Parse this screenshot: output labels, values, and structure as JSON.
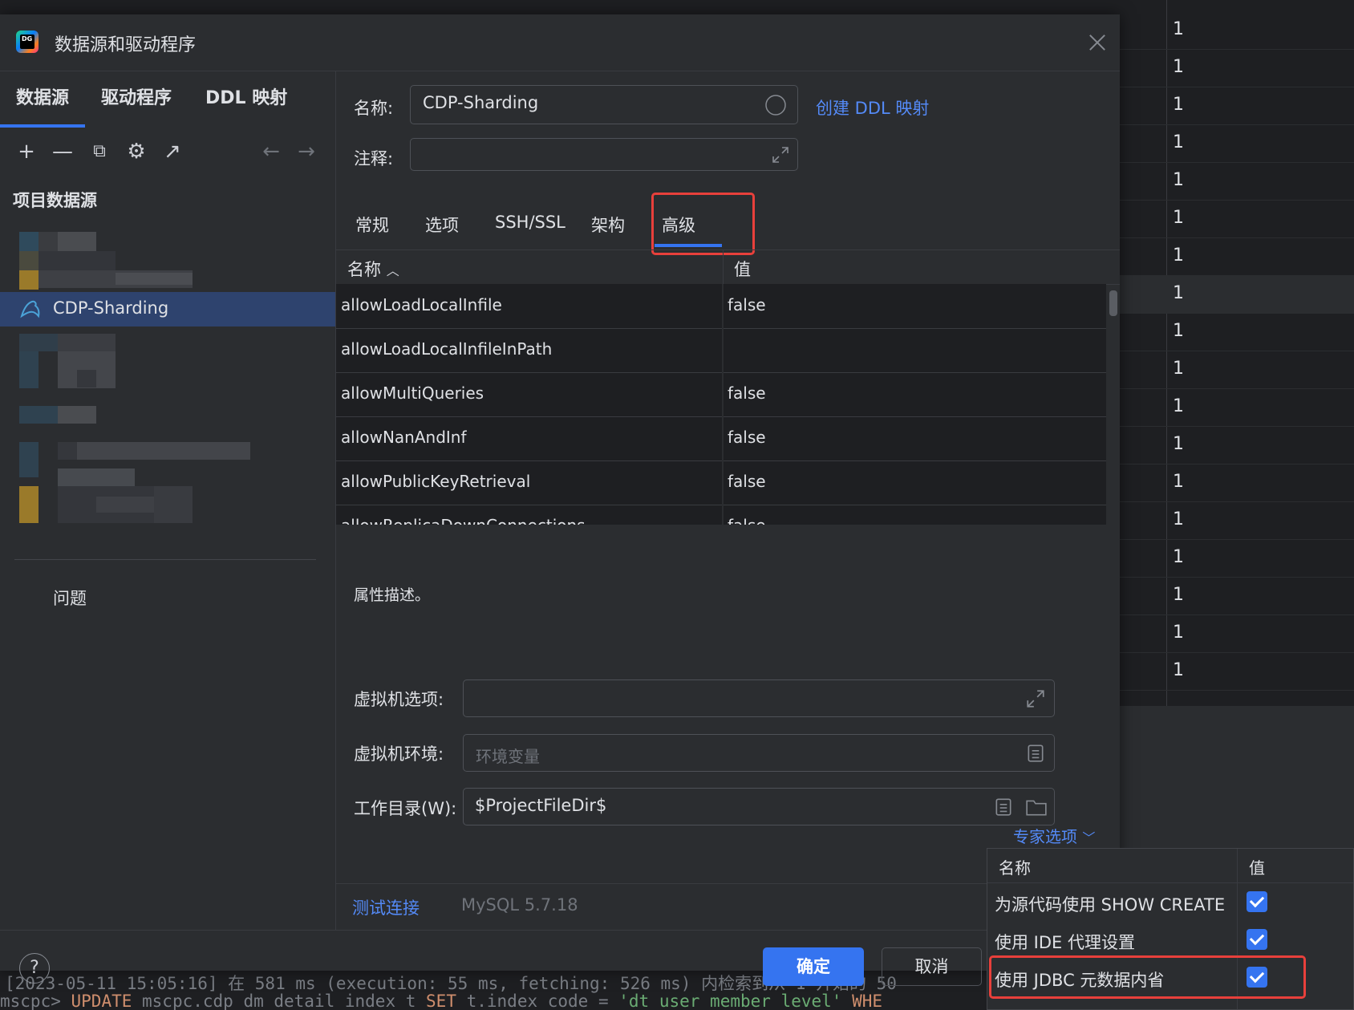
{
  "background": {
    "grid_values": [
      "1",
      "1",
      "1",
      "1",
      "1",
      "1",
      "1",
      "1",
      "1",
      "1",
      "1",
      "1",
      "1",
      "1",
      "1",
      "1",
      "1",
      "1"
    ],
    "console_line1": "[2023-05-11 15:05:16] 在 581 ms (execution: 55 ms, fetching: 526 ms) 内检索到从 1 开始的 50",
    "console_prefix": "mscpc> ",
    "console_kw1": "UPDATE",
    "console_mid": " mscpc.cdp_dm_detail_index t ",
    "console_kw2": "SET",
    "console_mid2": " t.index_code = ",
    "console_str": "'dt_user_member_level'",
    "console_kw3": " WHE"
  },
  "dialog": {
    "logo_text": "DG",
    "title": "数据源和驱动程序"
  },
  "left": {
    "tabs": [
      "数据源",
      "驱动程序",
      "DDL 映射"
    ],
    "toolbar": {
      "add": "+",
      "remove": "—",
      "copy": "⧉",
      "settings": "⚙",
      "open": "↗",
      "back": "←",
      "forward": "→"
    },
    "section_title": "项目数据源",
    "selected_datasource": "CDP-Sharding",
    "problems": "问题"
  },
  "form": {
    "name_label": "名称:",
    "name_value": "CDP-Sharding",
    "create_ddl_link": "创建 DDL 映射",
    "comment_label": "注释:",
    "comment_value": "",
    "tabs": [
      "常规",
      "选项",
      "SSH/SSL",
      "架构",
      "高级"
    ],
    "active_tab": "高级",
    "table": {
      "col_name": "名称",
      "col_value": "值",
      "rows": [
        {
          "key": "allowLoadLocalInfile",
          "value": "false"
        },
        {
          "key": "allowLoadLocalInfileInPath",
          "value": ""
        },
        {
          "key": "allowMultiQueries",
          "value": "false"
        },
        {
          "key": "allowNanAndInf",
          "value": "false"
        },
        {
          "key": "allowPublicKeyRetrieval",
          "value": "false"
        },
        {
          "key": "allowReplicaDownConnections",
          "value": "false"
        }
      ]
    },
    "prop_description": "属性描述。",
    "vm_options_label": "虚拟机选项:",
    "vm_options_value": "",
    "vm_env_label": "虚拟机环境:",
    "vm_env_placeholder": "环境变量",
    "workdir_label": "工作目录(W):",
    "workdir_value": "$ProjectFileDir$",
    "expert_link": "专家选项",
    "test_link": "测试连接",
    "driver_version": "MySQL 5.7.18"
  },
  "footer": {
    "help": "?",
    "ok": "确定",
    "cancel": "取消"
  },
  "expert_popup": {
    "col_name": "名称",
    "col_value": "值",
    "rows": [
      {
        "label": "为源代码使用 SHOW CREATE",
        "checked": true
      },
      {
        "label": "使用 IDE 代理设置",
        "checked": true
      },
      {
        "label": "使用 JDBC 元数据内省",
        "checked": true
      }
    ]
  },
  "colors": {
    "accent": "#3574f0",
    "link": "#548af7",
    "highlight_box": "#e8403b",
    "selection": "#2e436e"
  }
}
